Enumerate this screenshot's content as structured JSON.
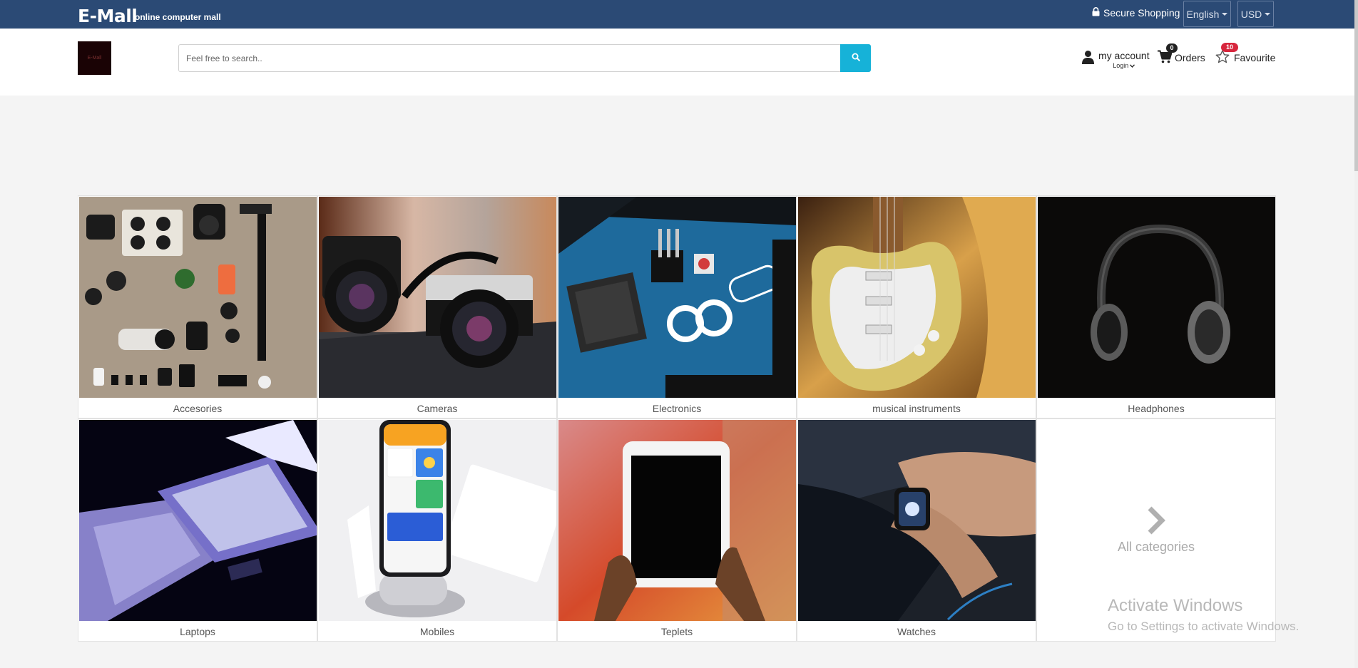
{
  "topbar": {
    "brand": "E-Mall",
    "tagline": "online computer mall",
    "secure_label": "Secure Shopping",
    "language": "English",
    "currency": "USD"
  },
  "header": {
    "logo_text": "E-Mall",
    "search_placeholder": "Feel free to search..",
    "account_label": "my account",
    "login_label": "Login",
    "orders_label": "Orders",
    "orders_count": "0",
    "favourite_label": "Favourite",
    "favourite_count": "10"
  },
  "categories": [
    {
      "label": "Accesories",
      "image": "accessories-photo"
    },
    {
      "label": "Cameras",
      "image": "cameras-photo"
    },
    {
      "label": "Electronics",
      "image": "arduino-board-photo"
    },
    {
      "label": "musical instruments",
      "image": "electric-guitar-photo"
    },
    {
      "label": "Headphones",
      "image": "headphones-photo"
    },
    {
      "label": "Laptops",
      "image": "laptop-photo"
    },
    {
      "label": "Mobiles",
      "image": "smartphone-photo"
    },
    {
      "label": "Teplets",
      "image": "tablet-photo"
    },
    {
      "label": "Watches",
      "image": "smartwatch-photo"
    }
  ],
  "all_categories_label": "All categories",
  "watermark": {
    "line1": "Activate Windows",
    "line2": "Go to Settings to activate Windows."
  },
  "colors": {
    "topbar_bg": "#2b4a75",
    "search_button": "#16b2d8",
    "fav_badge": "#d7263d"
  }
}
